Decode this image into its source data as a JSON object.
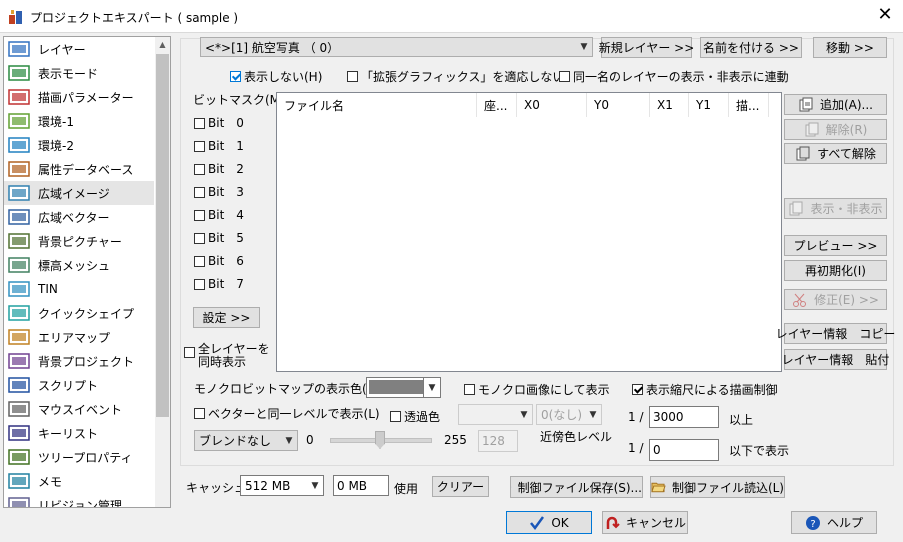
{
  "window": {
    "title": "プロジェクトエキスパート ( sample )"
  },
  "sidebar": {
    "items": [
      {
        "label": "レイヤー",
        "icon": "layers-icon"
      },
      {
        "label": "表示モード",
        "icon": "display-mode-icon"
      },
      {
        "label": "描画パラメーター",
        "icon": "draw-parameter-icon"
      },
      {
        "label": "環境-1",
        "icon": "environment-1-icon"
      },
      {
        "label": "環境-2",
        "icon": "environment-2-icon"
      },
      {
        "label": "属性データベース",
        "icon": "attribute-database-icon"
      },
      {
        "label": "広域イメージ",
        "icon": "wide-image-icon"
      },
      {
        "label": "広域ベクター",
        "icon": "wide-vector-icon"
      },
      {
        "label": "背景ピクチャー",
        "icon": "background-picture-icon"
      },
      {
        "label": "標高メッシュ",
        "icon": "elevation-mesh-icon"
      },
      {
        "label": "TIN",
        "icon": "tin-icon"
      },
      {
        "label": "クイックシェイプ",
        "icon": "quick-shape-icon"
      },
      {
        "label": "エリアマップ",
        "icon": "area-map-icon"
      },
      {
        "label": "背景プロジェクト",
        "icon": "background-project-icon"
      },
      {
        "label": "スクリプト",
        "icon": "script-icon"
      },
      {
        "label": "マウスイベント",
        "icon": "mouse-event-icon"
      },
      {
        "label": "キーリスト",
        "icon": "key-list-icon"
      },
      {
        "label": "ツリープロパティ",
        "icon": "tree-property-icon"
      },
      {
        "label": "メモ",
        "icon": "memo-icon"
      },
      {
        "label": "リビジョン管理",
        "icon": "revision-icon"
      }
    ],
    "selected_index": 6
  },
  "layer": {
    "select_value": "<*>[1] 航空写真  （ 0）"
  },
  "top_buttons": {
    "new_layer": "新規レイヤー >>",
    "rename": "名前を付ける >>",
    "move": "移動 >>"
  },
  "options": {
    "hide": "表示しない(H)",
    "no_ext_graphics": "「拡張グラフィックス」を適応しない",
    "same_name_link": "同一名のレイヤーの表示・非表示に連動"
  },
  "bitmask": {
    "label": "ビットマスク(M)",
    "bits": [
      {
        "label": "Bit",
        "index": "0"
      },
      {
        "label": "Bit",
        "index": "1"
      },
      {
        "label": "Bit",
        "index": "2"
      },
      {
        "label": "Bit",
        "index": "3"
      },
      {
        "label": "Bit",
        "index": "4"
      },
      {
        "label": "Bit",
        "index": "5"
      },
      {
        "label": "Bit",
        "index": "6"
      },
      {
        "label": "Bit",
        "index": "7"
      }
    ],
    "settings_button": "設定 >>"
  },
  "file_list": {
    "columns": [
      "ファイル名",
      "座...",
      "X0",
      "Y0",
      "X1",
      "Y1",
      "描..."
    ]
  },
  "right_buttons": {
    "add": "追加(A)...",
    "remove": "解除(R)",
    "remove_all": "すべて解除",
    "show_hide": "表示・非表示",
    "preview": "プレビュー >>",
    "reinit": "再初期化(I)",
    "modify": "修正(E) >>",
    "layer_info_copy": "レイヤー情報　コピー",
    "layer_info_paste": "レイヤー情報　貼付"
  },
  "all_layers_simultaneous": {
    "line1": "全レイヤーを",
    "line2": "同時表示"
  },
  "mono": {
    "color_label": "モノクロビットマップの表示色(C)",
    "color_value": "#808080",
    "mono_image": "モノクロ画像にして表示",
    "scale_limit": "表示縮尺による描画制御"
  },
  "vector_same_level": "ベクターと同一レベルで表示(L)",
  "transparency": {
    "label": "透過色",
    "value": "",
    "near": "0(なし)",
    "near_label": "近傍色レベル"
  },
  "blend": {
    "value": "ブレンドなし",
    "min": "0",
    "max": "255",
    "current": "128"
  },
  "scale": {
    "prefix1": "1 /",
    "upper_value": "3000",
    "upper_suffix": "以上",
    "prefix2": "1 /",
    "lower_value": "0",
    "lower_suffix": "以下で表示"
  },
  "cache": {
    "label": "キャッシュ",
    "size": "512 MB",
    "used_value": "0 MB",
    "used_label": "使用",
    "clear_button": "クリアー"
  },
  "control_file": {
    "save": "制御ファイル保存(S)...",
    "load": "制御ファイル読込(L)"
  },
  "dialog_buttons": {
    "ok": "OK",
    "cancel": "キャンセル",
    "help": "ヘルプ"
  }
}
